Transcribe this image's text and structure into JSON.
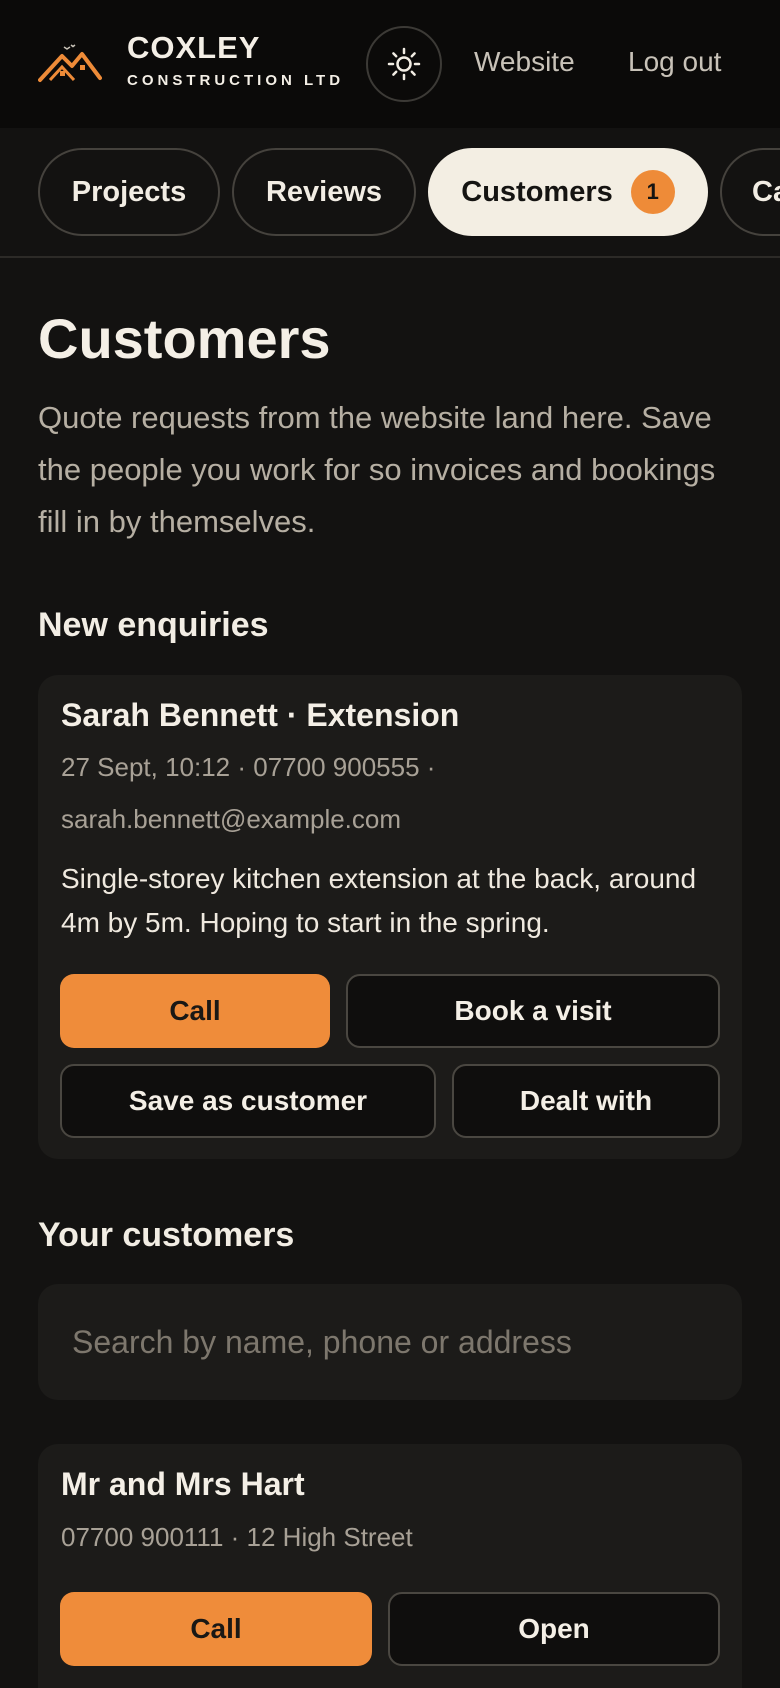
{
  "brand": {
    "name": "COXLEY",
    "subtitle": "CONSTRUCTION LTD",
    "accent_color": "#ef8c3a"
  },
  "header": {
    "theme_icon": "sun-icon",
    "website_label": "Website",
    "logout_label": "Log out"
  },
  "tabs": [
    {
      "label": "Projects",
      "active": false
    },
    {
      "label": "Reviews",
      "active": false
    },
    {
      "label": "Customers",
      "active": true,
      "badge": "1"
    },
    {
      "label": "Ca",
      "active": false
    }
  ],
  "page": {
    "title": "Customers",
    "intro": "Quote requests from the website land here. Save the people you work for so invoices and bookings fill in by themselves."
  },
  "enquiries": {
    "heading": "New enquiries",
    "items": [
      {
        "title": "Sarah Bennett · Extension",
        "meta_line1": "27 Sept, 10:12 · 07700 900555 ·",
        "meta_line2": "sarah.bennett@example.com",
        "message": "Single-storey kitchen extension at the back, around 4m by 5m. Hoping to start in the spring.",
        "call_label": "Call",
        "book_label": "Book a visit",
        "save_label": "Save as customer",
        "dealt_label": "Dealt with"
      }
    ]
  },
  "customers": {
    "heading": "Your customers",
    "search_placeholder": "Search by name, phone or address",
    "items": [
      {
        "name": "Mr and Mrs Hart",
        "meta": "07700 900111 · 12 High Street",
        "call_label": "Call",
        "open_label": "Open"
      }
    ]
  }
}
